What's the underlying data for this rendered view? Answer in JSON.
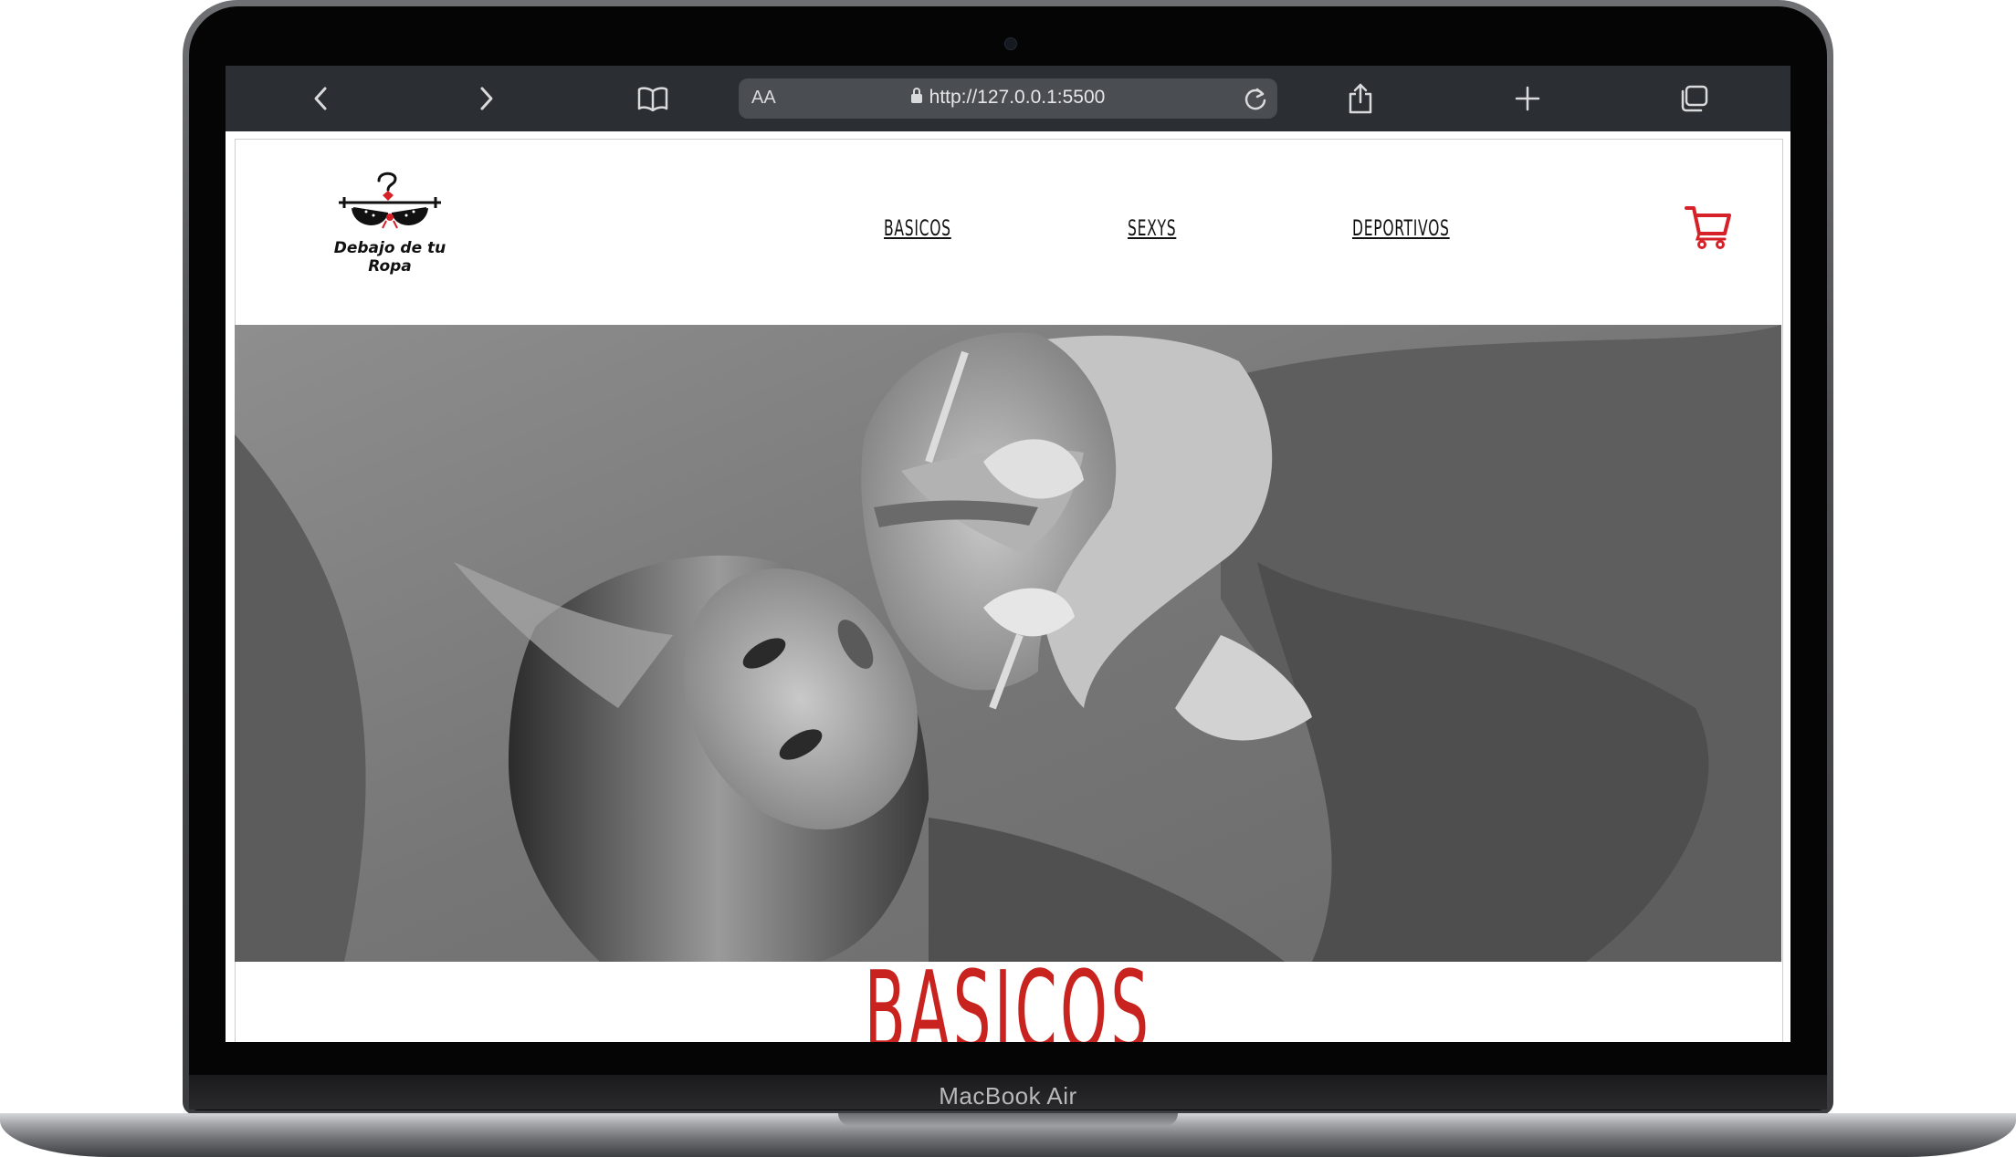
{
  "device": {
    "model_label": "MacBook Air"
  },
  "browser": {
    "text_size_label": "AA",
    "address": "http://127.0.0.1:5500",
    "icons": {
      "back": "chevron-left-icon",
      "forward": "chevron-right-icon",
      "bookmarks": "book-icon",
      "lock": "lock-icon",
      "reload": "reload-icon",
      "share": "share-icon",
      "new_tab": "plus-icon",
      "tabs": "tabs-icon"
    }
  },
  "site": {
    "logo_text": "Debajo de tu Ropa",
    "nav": [
      {
        "label": "BASICOS"
      },
      {
        "label": "SEXYS"
      },
      {
        "label": "DEPORTIVOS"
      }
    ],
    "cart_icon": "shopping-cart-icon",
    "accent_color": "#c8231f",
    "hero_image": "black-and-white photo of a woman lying on bed sheets",
    "section_title": "BASICOS"
  }
}
